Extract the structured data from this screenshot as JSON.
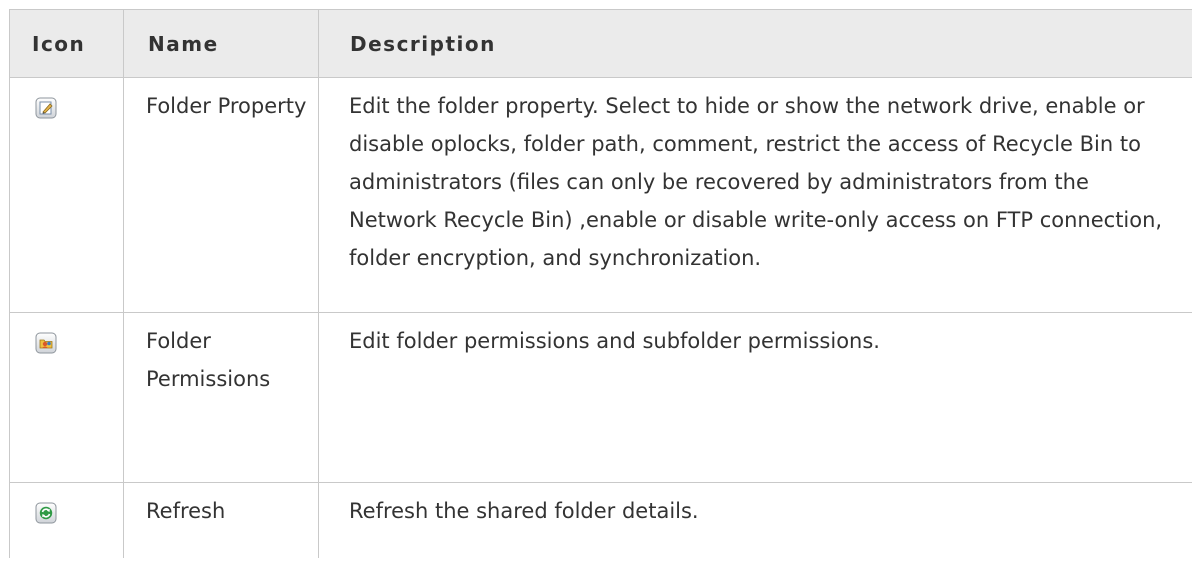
{
  "table": {
    "headers": {
      "icon": "Icon",
      "name": "Name",
      "description": "Description"
    },
    "rows": [
      {
        "icon": "edit-pencil-icon",
        "name": "Folder Property",
        "description": "Edit the folder property. Select to hide or show the network drive, enable or disable oplocks, folder path, comment, restrict the access of Recycle Bin to administrators (files can only be recovered by administrators from the Network Recycle Bin) ,enable or disable write-only access on FTP connection, folder encryption, and synchronization."
      },
      {
        "icon": "folder-permissions-icon",
        "name": "Folder Permissions",
        "description": "Edit folder permissions and subfolder permissions."
      },
      {
        "icon": "refresh-icon",
        "name": "Refresh",
        "description": "Refresh the shared folder details."
      }
    ]
  }
}
